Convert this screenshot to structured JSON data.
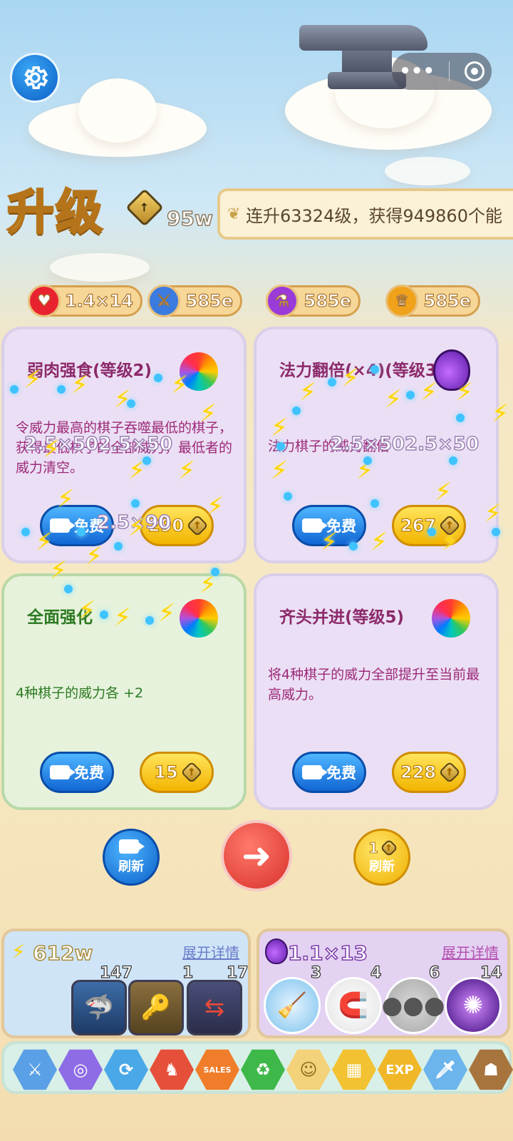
{
  "header": {
    "settings_icon": "gear-icon",
    "capsule_more": "•••",
    "capsule_close_icon": "target-icon"
  },
  "upgrade": {
    "title": "升级",
    "points": "95w",
    "banner_text": "连升63324级，获得949860个能"
  },
  "resources": [
    {
      "icon": "heart-icon",
      "color": "#e8232f",
      "value": "1.4×14"
    },
    {
      "icon": "sword-icon",
      "color": "#3b7be0",
      "value": "585e"
    },
    {
      "icon": "potion-icon",
      "color": "#9a3ad8",
      "value": "585e"
    },
    {
      "icon": "crown-icon",
      "color": "#f0a21b",
      "value": "585e"
    }
  ],
  "cards": [
    {
      "title": "弱肉强食(等级2)",
      "desc": "令威力最高的棋子吞噬最低的棋子，获得最低棋子的全部威力，最低者的威力清空。",
      "free_label": "免费",
      "cost": "290",
      "overlay": "2.5×502.5×50",
      "overlay_btn": "2.5×90"
    },
    {
      "title": "法力翻倍(×4)(等级3)",
      "desc": "法力棋子的威力翻倍",
      "free_label": "免费",
      "cost": "267",
      "overlay": "2.5×502.5×50"
    },
    {
      "title": "全面强化",
      "desc": "4种棋子的威力各 +2",
      "free_label": "免费",
      "cost": "15"
    },
    {
      "title": "齐头并进(等级5)",
      "desc": "将4种棋子的威力全部提升至当前最高威力。",
      "free_label": "免费",
      "cost": "228"
    }
  ],
  "actions": {
    "refresh_video_label": "刷新",
    "go_icon": "arrow-right-icon",
    "refresh_cost_num": "1",
    "refresh_cost_label": "刷新"
  },
  "panels": {
    "left": {
      "value": "612w",
      "link": "展开详情",
      "items": [
        {
          "icon": "shark-icon",
          "count": "147"
        },
        {
          "icon": "key-icon",
          "count": "1"
        },
        {
          "icon": "swap-icon",
          "count": "17"
        }
      ]
    },
    "right": {
      "value": "1.1×13",
      "link": "展开详情",
      "items": [
        {
          "icon": "mop-icon",
          "count": "3"
        },
        {
          "icon": "magnet-icon",
          "count": "4"
        },
        {
          "icon": "stones-icon",
          "count": "6"
        },
        {
          "icon": "vortex-icon",
          "count": "14"
        }
      ]
    }
  },
  "bottom_bar": [
    {
      "icon": "crossed-swords-icon",
      "color": "#5aa0e6"
    },
    {
      "icon": "rings-icon",
      "color": "#8e6ce6"
    },
    {
      "icon": "refresh-icon",
      "color": "#4aa8e8"
    },
    {
      "icon": "warrior-icon",
      "color": "#e6503a"
    },
    {
      "icon": "sales-icon",
      "color": "#f07d2a",
      "text": "SALES"
    },
    {
      "icon": "recycle-icon",
      "color": "#3fb84a"
    },
    {
      "icon": "angel-icon",
      "color": "#f4d27a"
    },
    {
      "icon": "blocks-icon",
      "color": "#f2c233"
    },
    {
      "icon": "exp-icon",
      "color": "#f0b829",
      "text": "EXP"
    },
    {
      "icon": "ice-sword-icon",
      "color": "#6cb5ec"
    },
    {
      "icon": "golem-icon",
      "color": "#a8743e"
    }
  ]
}
